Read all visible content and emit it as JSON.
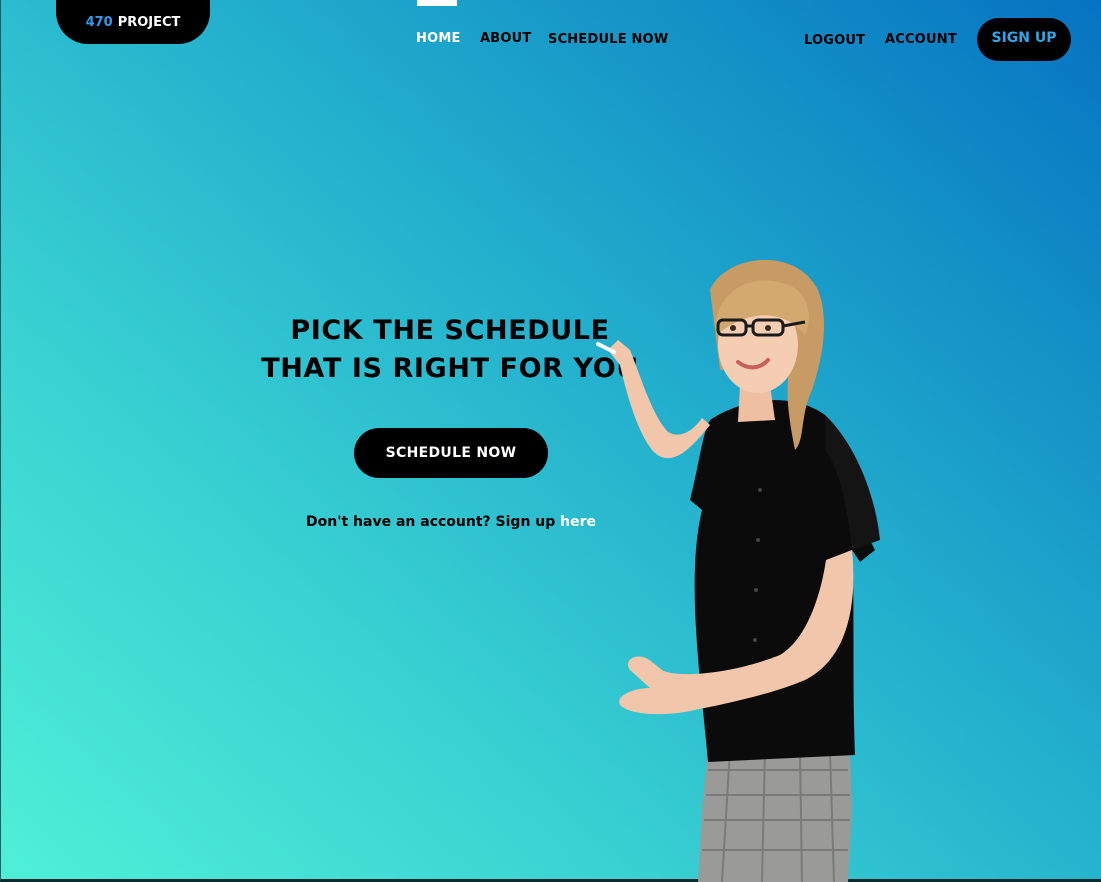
{
  "logo": {
    "number": "470",
    "text": "PROJECT"
  },
  "nav": {
    "home": "HOME",
    "about": "ABOUT",
    "schedule": "SCHEDULE NOW",
    "logout": "LOGOUT",
    "account": "ACCOUNT",
    "signup": "SIGN UP"
  },
  "hero": {
    "title_line1": "PICK THE SCHEDULE",
    "title_line2": "THAT IS RIGHT FOR YOU",
    "cta": "SCHEDULE NOW",
    "signup_prompt": "Don't have an account? Sign up",
    "signup_link": "here"
  },
  "illustration": {
    "subject": "woman-teacher-pointing-image"
  },
  "colors": {
    "accent_blue": "#2f9bf0",
    "gradient_start": "#4ff0d8",
    "gradient_end": "#0673c2"
  }
}
